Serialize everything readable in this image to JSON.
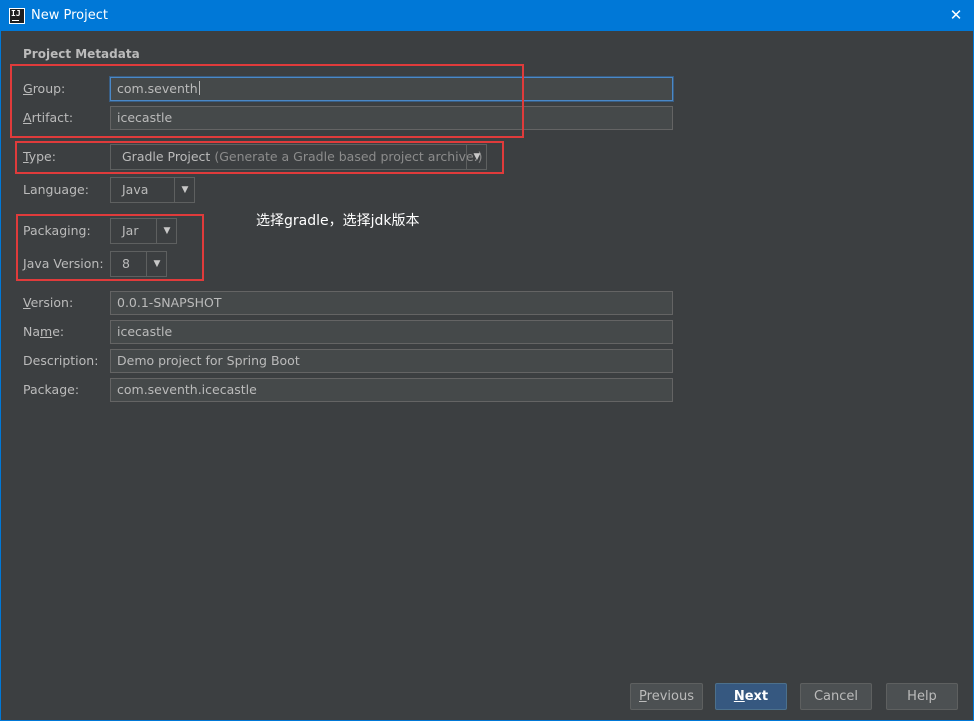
{
  "window": {
    "title": "New Project",
    "close_glyph": "✕",
    "app_icon": "IJ"
  },
  "section_title": "Project Metadata",
  "fields": {
    "group": {
      "mnemonic": "G",
      "label_rest": "roup:",
      "value": "com.seventh"
    },
    "artifact": {
      "mnemonic": "A",
      "label_rest": "rtifact:",
      "value": "icecastle"
    },
    "type": {
      "mnemonic": "T",
      "label_rest": "ype:",
      "value": "Gradle Project",
      "hint": "(Generate a Gradle based project archive.)"
    },
    "language": {
      "label": "Language:",
      "value": "Java"
    },
    "packaging": {
      "label": "Packaging:",
      "value": "Jar"
    },
    "java_version": {
      "mnemonic": "J",
      "label_rest": "ava Version:",
      "value": "8"
    },
    "version": {
      "mnemonic": "V",
      "label_rest": "ersion:",
      "value": "0.0.1-SNAPSHOT"
    },
    "name": {
      "label_pre": "Na",
      "mnemonic": "m",
      "label_rest": "e:",
      "value": "icecastle"
    },
    "description": {
      "label": "Description:",
      "value": "Demo project for Spring Boot"
    },
    "package": {
      "label": "Package:",
      "value": "com.seventh.icecastle"
    }
  },
  "dropdown_arrow": "▼",
  "annotation": "选择gradle，选择jdk版本",
  "highlight_color": "#e03b3b",
  "buttons": {
    "previous": {
      "mnemonic": "P",
      "rest": "revious"
    },
    "next": {
      "mnemonic": "N",
      "rest": "ext"
    },
    "cancel": "Cancel",
    "help": "Help"
  }
}
